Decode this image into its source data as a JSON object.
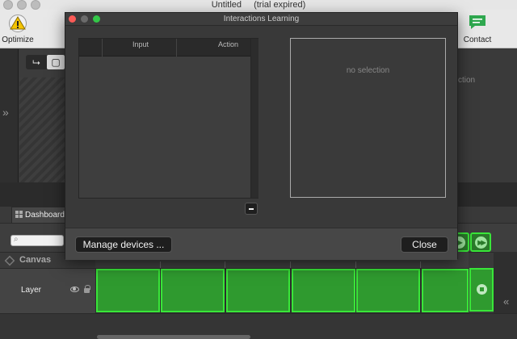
{
  "app": {
    "title": "Untitled",
    "title_suffix": "(trial expired)"
  },
  "toolbar": {
    "optimize_label": "Optimize",
    "contact_label": "Contact"
  },
  "background_panel": {
    "right_partial_text": "ction"
  },
  "dashboard": {
    "tab_label": "Dashboard",
    "canvas_label": "Canvas",
    "layer_label": "Layer"
  },
  "dialog": {
    "title": "Interactions Learning",
    "table": {
      "columns": [
        "Input",
        "Action"
      ],
      "rows": []
    },
    "detail_placeholder": "no selection",
    "manage_devices_label": "Manage devices ...",
    "close_label": "Close"
  },
  "colors": {
    "accent_green": "#39e639",
    "warning_yellow": "#f5c400"
  },
  "icons": {
    "optimize": "warning-triangle-icon",
    "contact": "chat-bubble-icon"
  }
}
